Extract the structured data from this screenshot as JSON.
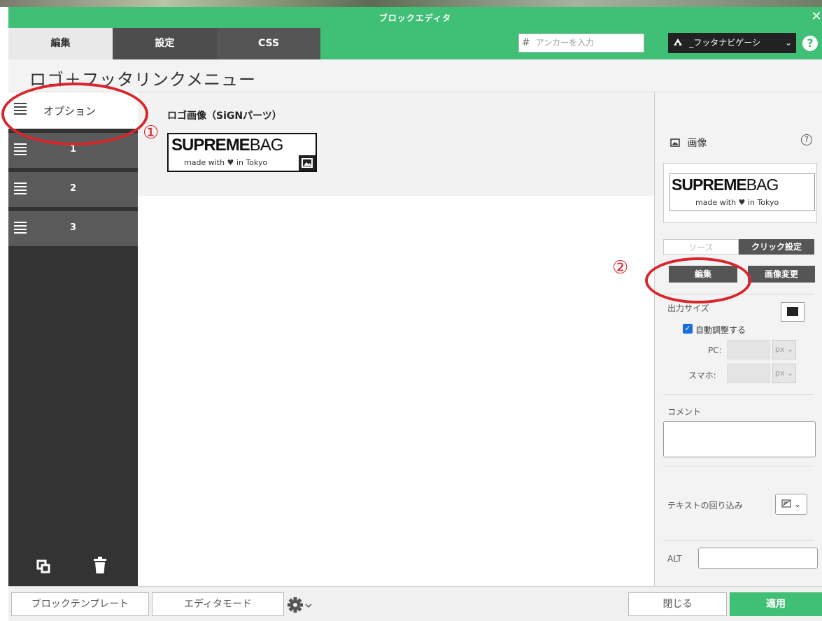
{
  "window": {
    "title": "ブロックエディタ",
    "close_glyph": "✕"
  },
  "tabs": [
    {
      "label": "編集"
    },
    {
      "label": "設定"
    },
    {
      "label": "CSS"
    }
  ],
  "header": {
    "anchor_placeholder": "アンカーを入力",
    "anchor_hash": "#",
    "nav_select_value": "_フッタナビゲーシ",
    "help_glyph": "?"
  },
  "page_title": "ロゴ＋フッタリンクメニュー",
  "sidebar": {
    "items": [
      {
        "label": "オプション"
      },
      {
        "label": "1"
      },
      {
        "label": "2"
      },
      {
        "label": "3"
      }
    ]
  },
  "main": {
    "logo_label": "ロゴ画像（SiGNパーツ）",
    "logo": {
      "bold": "SUPREME",
      "light": "BAG",
      "tagline_before": "made with",
      "heart": "♥",
      "tagline_after": "in Tokyo"
    }
  },
  "annotations": {
    "one": "①",
    "two": "②"
  },
  "right_panel": {
    "image_label": "画像",
    "help_glyph": "?",
    "subtab_left": "ソース",
    "subtab_right": "クリック設定",
    "edit_button": "編集",
    "change_button": "画像変更",
    "output_size_label": "出力サイズ",
    "auto_adjust_label": "自動調整する",
    "auto_adjust_checked": true,
    "pc_label": "PC:",
    "sp_label": "スマホ:",
    "unit": "px",
    "comment_label": "コメント",
    "wrap_label": "テキストの回り込み",
    "alt_label": "ALT"
  },
  "footer": {
    "template_button": "ブロックテンプレート",
    "mode_button": "エディタモード",
    "close_button": "閉じる",
    "apply_button": "適用"
  },
  "colors": {
    "accent": "#40bf77",
    "dark": "#333333",
    "annotation_red": "#d9262c"
  }
}
